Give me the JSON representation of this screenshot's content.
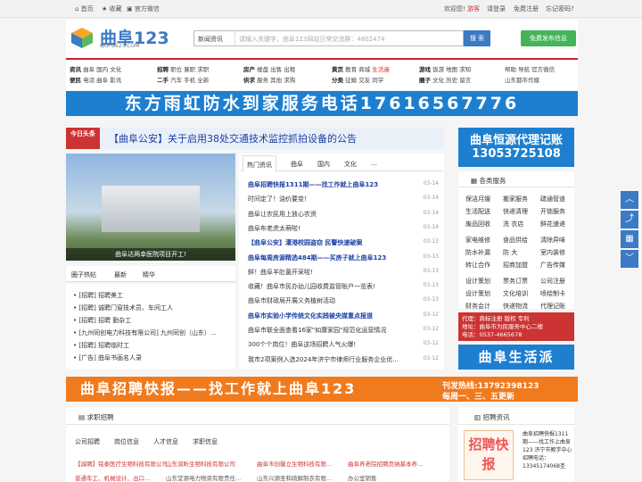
{
  "topbar": {
    "left": [
      "首页",
      "收藏",
      "官方微信"
    ],
    "right": [
      "欢迎您!",
      "游客",
      "请登录",
      "免费注册",
      "忘记密码?"
    ]
  },
  "header": {
    "logo_text": "曲阜123",
    "logo_sub": "QUFU123.COM",
    "search_category": "新闻资讯",
    "search_placeholder": "请输入关键字，曲阜123网站日常交流群：4802474",
    "search_button": "搜 索",
    "free_button": "免费发布信息"
  },
  "nav": {
    "groups": [
      [
        "资讯",
        "曲阜",
        "国内",
        "文化",
        "便民",
        "电话",
        "曲阜",
        "影讯"
      ],
      [
        "招聘",
        "职位",
        "兼职",
        "求职",
        "二手",
        "汽车",
        "手机",
        "全新"
      ],
      [
        "房产",
        "楼盘",
        "出售",
        "出租",
        "供求",
        "服务",
        "其他",
        "求购"
      ],
      [
        "黄页",
        "教育",
        "商城",
        "生活遍",
        "分类",
        "征婚",
        "交友",
        "同学"
      ],
      [
        "游戏",
        "饭游",
        "地图",
        "求知",
        "圈子",
        "文化",
        "历史",
        "留言"
      ],
      [
        "帮助",
        "导航",
        "官方微信",
        "山东都市作媒"
      ]
    ]
  },
  "banner1": "东方雨虹防水到家服务电话17616567776",
  "police": {
    "tag": "今日头条",
    "text": "【曲阜公安】关于启用38处交通技术监控抓拍设备的公告"
  },
  "right_ad1": {
    "line1": "曲阜恒源代理记账",
    "line2": "13053725108"
  },
  "photo_caption": "曲阜达两幸医院项目开工!",
  "left_tabs": [
    "圈子热帖",
    "最新",
    "精华"
  ],
  "left_list": [
    "[招聘] 招聘美工",
    "[招聘] 诚聘门窗技术员、车间工人",
    "[招聘] 招聘 勤杂工",
    "[九州同创电力科技有限公司] 九州同创（山东）...",
    "[招聘] 招聘临时工",
    "[广告] 曲阜书画名人录"
  ],
  "news_tabs": [
    "热门资讯",
    "曲阜",
    "国内",
    "文化"
  ],
  "news": [
    {
      "title": "曲阜招聘快报1311期——找工作就上曲阜123",
      "date": "03-14",
      "style": "blue"
    },
    {
      "title": "时间定了！油价要变！",
      "date": "03-14",
      "style": "normal"
    },
    {
      "title": "曲阜让农民用上放心农资",
      "date": "03-14",
      "style": "normal"
    },
    {
      "title": "曲阜布老虎太萌啦!",
      "date": "03-14",
      "style": "normal"
    },
    {
      "title": "【曲阜公安】灌港校园盗窃 民警快速破案",
      "date": "03-13",
      "style": "blue"
    },
    {
      "title": "曲阜每周房源精选484期——买房子就上曲阜123",
      "date": "03-13",
      "style": "blue"
    },
    {
      "title": "鲜！曲阜羊肚菌开采啦!",
      "date": "03-13",
      "style": "normal"
    },
    {
      "title": "收藏！曲阜市民办幼儿园收费监管账户一览表!",
      "date": "03-13",
      "style": "normal"
    },
    {
      "title": "曲阜市财政局开展义务植树活动",
      "date": "03-13",
      "style": "normal"
    },
    {
      "title": "曲阜市实验小学传统文化实践被央媒重点报道",
      "date": "03-12",
      "style": "blue"
    },
    {
      "title": "曲阜市联全面查看16家\"如康家园\"规范化运营情况",
      "date": "03-12",
      "style": "normal"
    },
    {
      "title": "300个个岗位！曲阜这场招聘人气火爆!",
      "date": "03-12",
      "style": "normal"
    },
    {
      "title": "我市2项案例入选2024年济宁市律师行业服务企业优...",
      "date": "03-12",
      "style": "normal"
    }
  ],
  "services": {
    "header": "各类服务",
    "items": [
      [
        "保洁月嫂",
        "搬家服务",
        "疏通管道"
      ],
      [
        "生活配送",
        "快递清理",
        "开锁服务"
      ],
      [
        "废品回收",
        "洗 衣店",
        "鲜花速递"
      ],
      [
        "家电维修",
        "食品供给",
        "清除异味"
      ],
      [
        "防水补漏",
        "防 大",
        "室内装修"
      ],
      [
        "转让合作",
        "招商加盟",
        "广告传媒"
      ],
      [
        "设计策划",
        "票务订票",
        "公司注册"
      ],
      [
        "设计策划",
        "文化培训",
        "喷绘制卡"
      ],
      [
        "财务会计",
        "快递物流",
        "代理记账"
      ]
    ]
  },
  "right_ad2": {
    "line1": "代理：商标注册 版权 专利",
    "line2": "地址：曲阜市为民服务中心二楼",
    "line3": "电话：0537-4665678"
  },
  "right_ad3": "曲阜生活派",
  "banner2": {
    "left": "曲阜招聘快报——找工作就上曲阜123",
    "right1": "刊发热线:13792398123",
    "right2": "每周一、三、五更新"
  },
  "jobs": {
    "header": "求职招聘",
    "tabs": [
      "公司招聘",
      "岗位信息",
      "人才信息",
      "求职信息"
    ],
    "companies": [
      "【诚聘】铭泰医疗生物科技有限公司",
      "山东润昕生物科技有限公司",
      "曲阜市创馨立生物科技有限...",
      "曲阜养老院招聘页纳基本养..."
    ],
    "row2": [
      "普通车工、机械设计、出口...",
      "山东堂源电力物资有限责任...",
      "山东兴源圣和疏解制衣有限...",
      "办公室销售"
    ]
  },
  "recruit_info": {
    "header": "招聘资讯",
    "img_text": "招聘快报",
    "text": "曲阜招聘快报1311期——找工作上曲阜123 济宁市教学中心招聘电话：13345174068圣"
  },
  "side_buttons": [
    "chevron-up",
    "share",
    "qr",
    "chevron-down"
  ]
}
